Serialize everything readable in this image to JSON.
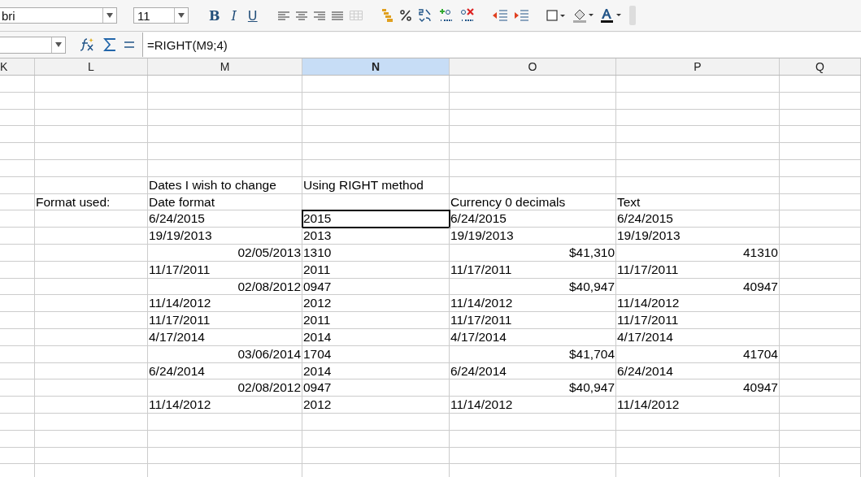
{
  "toolbar": {
    "font_name": "bri",
    "font_size": "11",
    "bold": "B",
    "italic": "I",
    "underline": "U"
  },
  "formula_bar": {
    "formula": "=RIGHT(M9;4)"
  },
  "columns": [
    {
      "label": "K",
      "selected": false
    },
    {
      "label": "L",
      "selected": false
    },
    {
      "label": "M",
      "selected": false
    },
    {
      "label": "N",
      "selected": true
    },
    {
      "label": "O",
      "selected": false
    },
    {
      "label": "P",
      "selected": false
    },
    {
      "label": "Q",
      "selected": false
    }
  ],
  "rows": [
    {},
    {},
    {},
    {},
    {},
    {},
    {
      "cells": {
        "M": {
          "text": "Dates I wish to change",
          "kind": "text",
          "selected": false
        },
        "N": {
          "text": "Using RIGHT method",
          "kind": "text",
          "selected": false
        }
      }
    },
    {
      "cells": {
        "L": {
          "text": "Format used:",
          "kind": "text",
          "selected": false
        },
        "M": {
          "text": "Date format",
          "kind": "text",
          "selected": false
        },
        "O": {
          "text": "Currency 0 decimals",
          "kind": "text",
          "selected": false
        },
        "P": {
          "text": "Text",
          "kind": "text",
          "selected": false
        }
      }
    },
    {
      "cells": {
        "M": {
          "text": "6/24/2015",
          "kind": "text",
          "selected": false
        },
        "N": {
          "text": "2015",
          "kind": "text",
          "selected": true
        },
        "O": {
          "text": "6/24/2015",
          "kind": "text",
          "selected": false
        },
        "P": {
          "text": "6/24/2015",
          "kind": "text",
          "selected": false
        }
      }
    },
    {
      "cells": {
        "M": {
          "text": "19/19/2013",
          "kind": "text",
          "selected": false
        },
        "N": {
          "text": "2013",
          "kind": "text",
          "selected": false
        },
        "O": {
          "text": "19/19/2013",
          "kind": "text",
          "selected": false
        },
        "P": {
          "text": "19/19/2013",
          "kind": "text",
          "selected": false
        }
      }
    },
    {
      "cells": {
        "M": {
          "text": "02/05/2013",
          "kind": "number",
          "selected": false
        },
        "N": {
          "text": "1310",
          "kind": "text",
          "selected": false
        },
        "O": {
          "text": "$41,310",
          "kind": "number",
          "selected": false
        },
        "P": {
          "text": "41310",
          "kind": "number",
          "selected": false
        }
      }
    },
    {
      "cells": {
        "M": {
          "text": "11/17/2011",
          "kind": "text",
          "selected": false
        },
        "N": {
          "text": "2011",
          "kind": "text",
          "selected": false
        },
        "O": {
          "text": "11/17/2011",
          "kind": "text",
          "selected": false
        },
        "P": {
          "text": "11/17/2011",
          "kind": "text",
          "selected": false
        }
      }
    },
    {
      "cells": {
        "M": {
          "text": "02/08/2012",
          "kind": "number",
          "selected": false
        },
        "N": {
          "text": "0947",
          "kind": "text",
          "selected": false
        },
        "O": {
          "text": "$40,947",
          "kind": "number",
          "selected": false
        },
        "P": {
          "text": "40947",
          "kind": "number",
          "selected": false
        }
      }
    },
    {
      "cells": {
        "M": {
          "text": "11/14/2012",
          "kind": "text",
          "selected": false
        },
        "N": {
          "text": "2012",
          "kind": "text",
          "selected": false
        },
        "O": {
          "text": "11/14/2012",
          "kind": "text",
          "selected": false
        },
        "P": {
          "text": "11/14/2012",
          "kind": "text",
          "selected": false
        }
      }
    },
    {
      "cells": {
        "M": {
          "text": "11/17/2011",
          "kind": "text",
          "selected": false
        },
        "N": {
          "text": "2011",
          "kind": "text",
          "selected": false
        },
        "O": {
          "text": "11/17/2011",
          "kind": "text",
          "selected": false
        },
        "P": {
          "text": "11/17/2011",
          "kind": "text",
          "selected": false
        }
      }
    },
    {
      "cells": {
        "M": {
          "text": "4/17/2014",
          "kind": "text",
          "selected": false
        },
        "N": {
          "text": "2014",
          "kind": "text",
          "selected": false
        },
        "O": {
          "text": "4/17/2014",
          "kind": "text",
          "selected": false
        },
        "P": {
          "text": "4/17/2014",
          "kind": "text",
          "selected": false
        }
      }
    },
    {
      "cells": {
        "M": {
          "text": "03/06/2014",
          "kind": "number",
          "selected": false
        },
        "N": {
          "text": "1704",
          "kind": "text",
          "selected": false
        },
        "O": {
          "text": "$41,704",
          "kind": "number",
          "selected": false
        },
        "P": {
          "text": "41704",
          "kind": "number",
          "selected": false
        }
      }
    },
    {
      "cells": {
        "M": {
          "text": "6/24/2014",
          "kind": "text",
          "selected": false
        },
        "N": {
          "text": "2014",
          "kind": "text",
          "selected": false
        },
        "O": {
          "text": "6/24/2014",
          "kind": "text",
          "selected": false
        },
        "P": {
          "text": "6/24/2014",
          "kind": "text",
          "selected": false
        }
      }
    },
    {
      "cells": {
        "M": {
          "text": "02/08/2012",
          "kind": "number",
          "selected": false
        },
        "N": {
          "text": "0947",
          "kind": "text",
          "selected": false
        },
        "O": {
          "text": "$40,947",
          "kind": "number",
          "selected": false
        },
        "P": {
          "text": "40947",
          "kind": "number",
          "selected": false
        }
      }
    },
    {
      "cells": {
        "M": {
          "text": "11/14/2012",
          "kind": "text",
          "selected": false
        },
        "N": {
          "text": "2012",
          "kind": "text",
          "selected": false
        },
        "O": {
          "text": "11/14/2012",
          "kind": "text",
          "selected": false
        },
        "P": {
          "text": "11/14/2012",
          "kind": "text",
          "selected": false
        }
      }
    },
    {},
    {},
    {},
    {}
  ]
}
